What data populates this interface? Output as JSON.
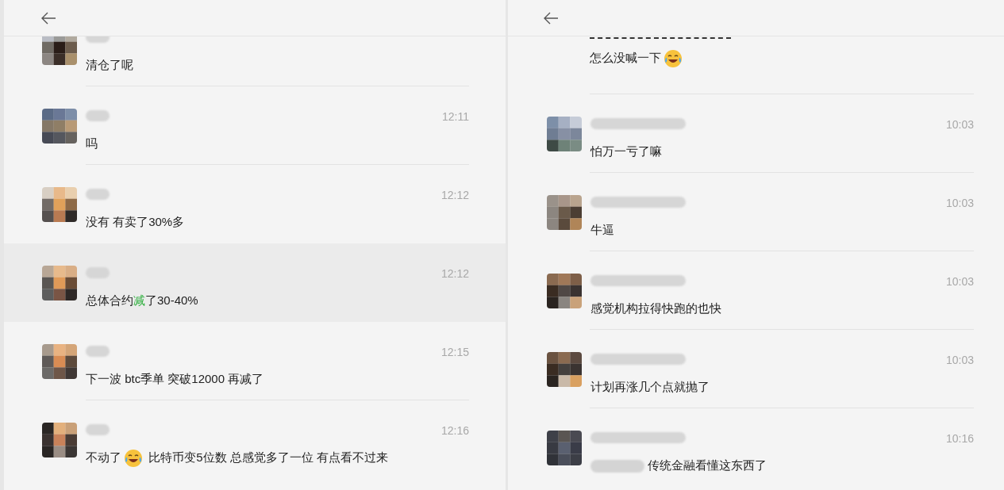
{
  "panels": [
    {
      "messages": [
        {
          "kind": "message",
          "parts": [
            {
              "kind": "text",
              "text": "清仓了呢"
            }
          ]
        },
        {
          "kind": "message",
          "time": "12:11",
          "parts": [
            {
              "kind": "text",
              "text": "吗"
            }
          ]
        },
        {
          "kind": "message",
          "time": "12:12",
          "parts": [
            {
              "kind": "text",
              "text": " 没有 有卖了30%多"
            }
          ]
        },
        {
          "kind": "message",
          "time": "12:12",
          "selected": true,
          "parts": [
            {
              "kind": "text",
              "text": "总体合约"
            },
            {
              "kind": "text",
              "text": "减",
              "highlighted": true
            },
            {
              "kind": "text",
              "text": "了30-40%"
            }
          ]
        },
        {
          "kind": "message",
          "time": "12:15",
          "parts": [
            {
              "kind": "text",
              "text": "下一波 btc季单 突破12000 再减了"
            }
          ]
        },
        {
          "kind": "message",
          "time": "12:16",
          "parts": [
            {
              "kind": "text",
              "text": "不动了"
            },
            {
              "kind": "emoji"
            },
            {
              "kind": "text",
              "text": " 比特币变5位数 总感觉多了一位 有点看不过来"
            }
          ]
        }
      ]
    },
    {
      "messages": [
        {
          "kind": "continuation",
          "parts": [
            {
              "kind": "text",
              "text": "怎么没喊一下"
            },
            {
              "kind": "emoji"
            }
          ]
        },
        {
          "kind": "message",
          "time": "10:03",
          "parts": [
            {
              "kind": "text",
              "text": "怕万一亏了嘛"
            }
          ]
        },
        {
          "kind": "message",
          "time": "10:03",
          "parts": [
            {
              "kind": "text",
              "text": "牛逼"
            }
          ]
        },
        {
          "kind": "message",
          "time": "10:03",
          "parts": [
            {
              "kind": "text",
              "text": "感觉机构拉得快跑的也快"
            }
          ]
        },
        {
          "kind": "message",
          "time": "10:03",
          "parts": [
            {
              "kind": "text",
              "text": "计划再涨几个点就抛了"
            }
          ]
        },
        {
          "kind": "message",
          "time": "10:16",
          "parts": [
            {
              "kind": "mention"
            },
            {
              "kind": "text",
              "text": " 传统金融看懂这东西了"
            }
          ]
        }
      ]
    }
  ]
}
